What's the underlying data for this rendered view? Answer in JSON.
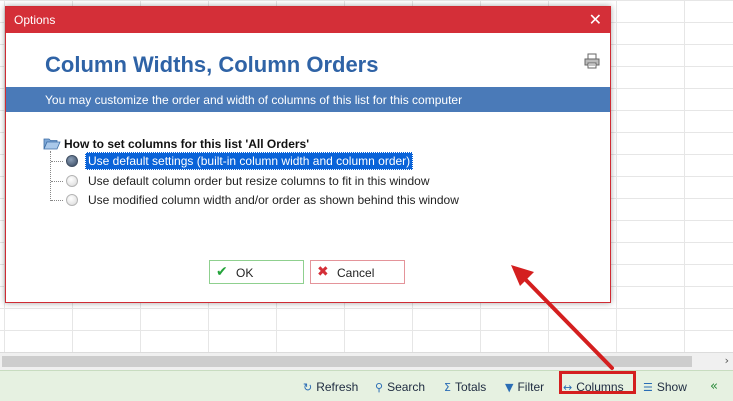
{
  "dialog": {
    "title": "Options",
    "heading": "Column Widths, Column Orders",
    "description": "You may customize the order and width of columns of this list for this computer",
    "tree_root": "How to set columns for this list 'All Orders'",
    "options": [
      {
        "label": "Use default settings (built-in column width and column order)",
        "selected": true
      },
      {
        "label": "Use default column order but resize columns to fit in this window",
        "selected": false
      },
      {
        "label": "Use modified column width and/or order as shown behind this window",
        "selected": false
      }
    ],
    "ok_label": "OK",
    "cancel_label": "Cancel"
  },
  "statusbar": {
    "refresh": "Refresh",
    "search": "Search",
    "totals": "Totals",
    "filter": "Filter",
    "columns": "Columns",
    "show": "Show"
  },
  "colors": {
    "titlebar": "#d42f38",
    "heading": "#2f63a6",
    "banner": "#4a7ab8",
    "selection": "#0a63d8",
    "statusbar": "#e6f1e1",
    "highlight": "#d41f1f"
  }
}
